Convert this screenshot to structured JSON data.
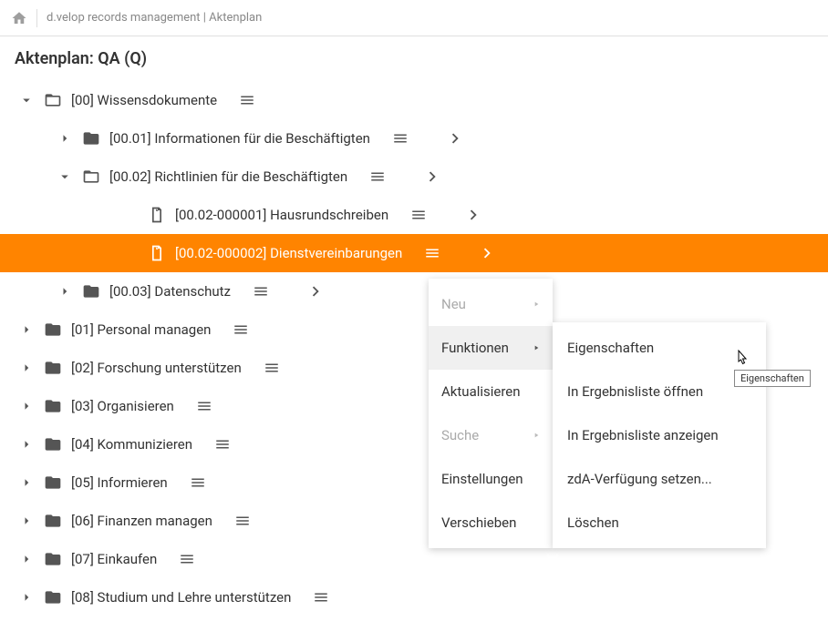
{
  "header": {
    "breadcrumb": "d.velop records management | Aktenplan"
  },
  "page": {
    "title": "Aktenplan: QA (Q)"
  },
  "tree": {
    "nodes": [
      {
        "label": "[00] Wissensdokumente",
        "icon": "folder-outline",
        "expanded": true,
        "indent": 0,
        "hasMenu": true,
        "hasNav": false
      },
      {
        "label": "[00.01] Informationen für die Beschäftigten",
        "icon": "folder-solid",
        "expanded": false,
        "indent": 1,
        "hasMenu": true,
        "hasNav": true
      },
      {
        "label": "[00.02] Richtlinien für die Beschäftigten",
        "icon": "folder-outline",
        "expanded": true,
        "indent": 1,
        "hasMenu": true,
        "hasNav": true
      },
      {
        "label": "[00.02-000001] Hausrundschreiben",
        "icon": "document",
        "expanded": null,
        "indent": 3,
        "hasMenu": true,
        "hasNav": true
      },
      {
        "label": "[00.02-000002] Dienstvereinbarungen",
        "icon": "document",
        "expanded": null,
        "indent": 3,
        "hasMenu": true,
        "hasNav": true,
        "selected": true
      },
      {
        "label": "[00.03] Datenschutz",
        "icon": "folder-solid",
        "expanded": false,
        "indent": 1,
        "hasMenu": true,
        "hasNav": true
      },
      {
        "label": "[01] Personal managen",
        "icon": "folder-solid",
        "expanded": false,
        "indent": 0,
        "hasMenu": true,
        "hasNav": false
      },
      {
        "label": "[02] Forschung unterstützen",
        "icon": "folder-solid",
        "expanded": false,
        "indent": 0,
        "hasMenu": true,
        "hasNav": false
      },
      {
        "label": "[03] Organisieren",
        "icon": "folder-solid",
        "expanded": false,
        "indent": 0,
        "hasMenu": true,
        "hasNav": false
      },
      {
        "label": "[04] Kommunizieren",
        "icon": "folder-solid",
        "expanded": false,
        "indent": 0,
        "hasMenu": true,
        "hasNav": false
      },
      {
        "label": "[05] Informieren",
        "icon": "folder-solid",
        "expanded": false,
        "indent": 0,
        "hasMenu": true,
        "hasNav": false
      },
      {
        "label": "[06] Finanzen managen",
        "icon": "folder-solid",
        "expanded": false,
        "indent": 0,
        "hasMenu": true,
        "hasNav": false
      },
      {
        "label": "[07] Einkaufen",
        "icon": "folder-solid",
        "expanded": false,
        "indent": 0,
        "hasMenu": true,
        "hasNav": false
      },
      {
        "label": "[08] Studium und Lehre unterstützen",
        "icon": "folder-solid",
        "expanded": false,
        "indent": 0,
        "hasMenu": true,
        "hasNav": false
      }
    ]
  },
  "contextMenu": {
    "items": [
      {
        "label": "Neu",
        "hasSubmenu": true,
        "disabled": true
      },
      {
        "label": "Funktionen",
        "hasSubmenu": true,
        "disabled": false,
        "hovered": true
      },
      {
        "label": "Aktualisieren",
        "hasSubmenu": false,
        "disabled": false
      },
      {
        "label": "Suche",
        "hasSubmenu": true,
        "disabled": true
      },
      {
        "label": "Einstellungen",
        "hasSubmenu": false,
        "disabled": false
      },
      {
        "label": "Verschieben",
        "hasSubmenu": false,
        "disabled": false
      }
    ]
  },
  "submenu": {
    "items": [
      {
        "label": "Eigenschaften"
      },
      {
        "label": "In Ergebnisliste öffnen"
      },
      {
        "label": "In Ergebnisliste anzeigen"
      },
      {
        "label": "zdA-Verfügung setzen..."
      },
      {
        "label": "Löschen"
      }
    ]
  },
  "tooltip": {
    "text": "Eigenschaften"
  }
}
